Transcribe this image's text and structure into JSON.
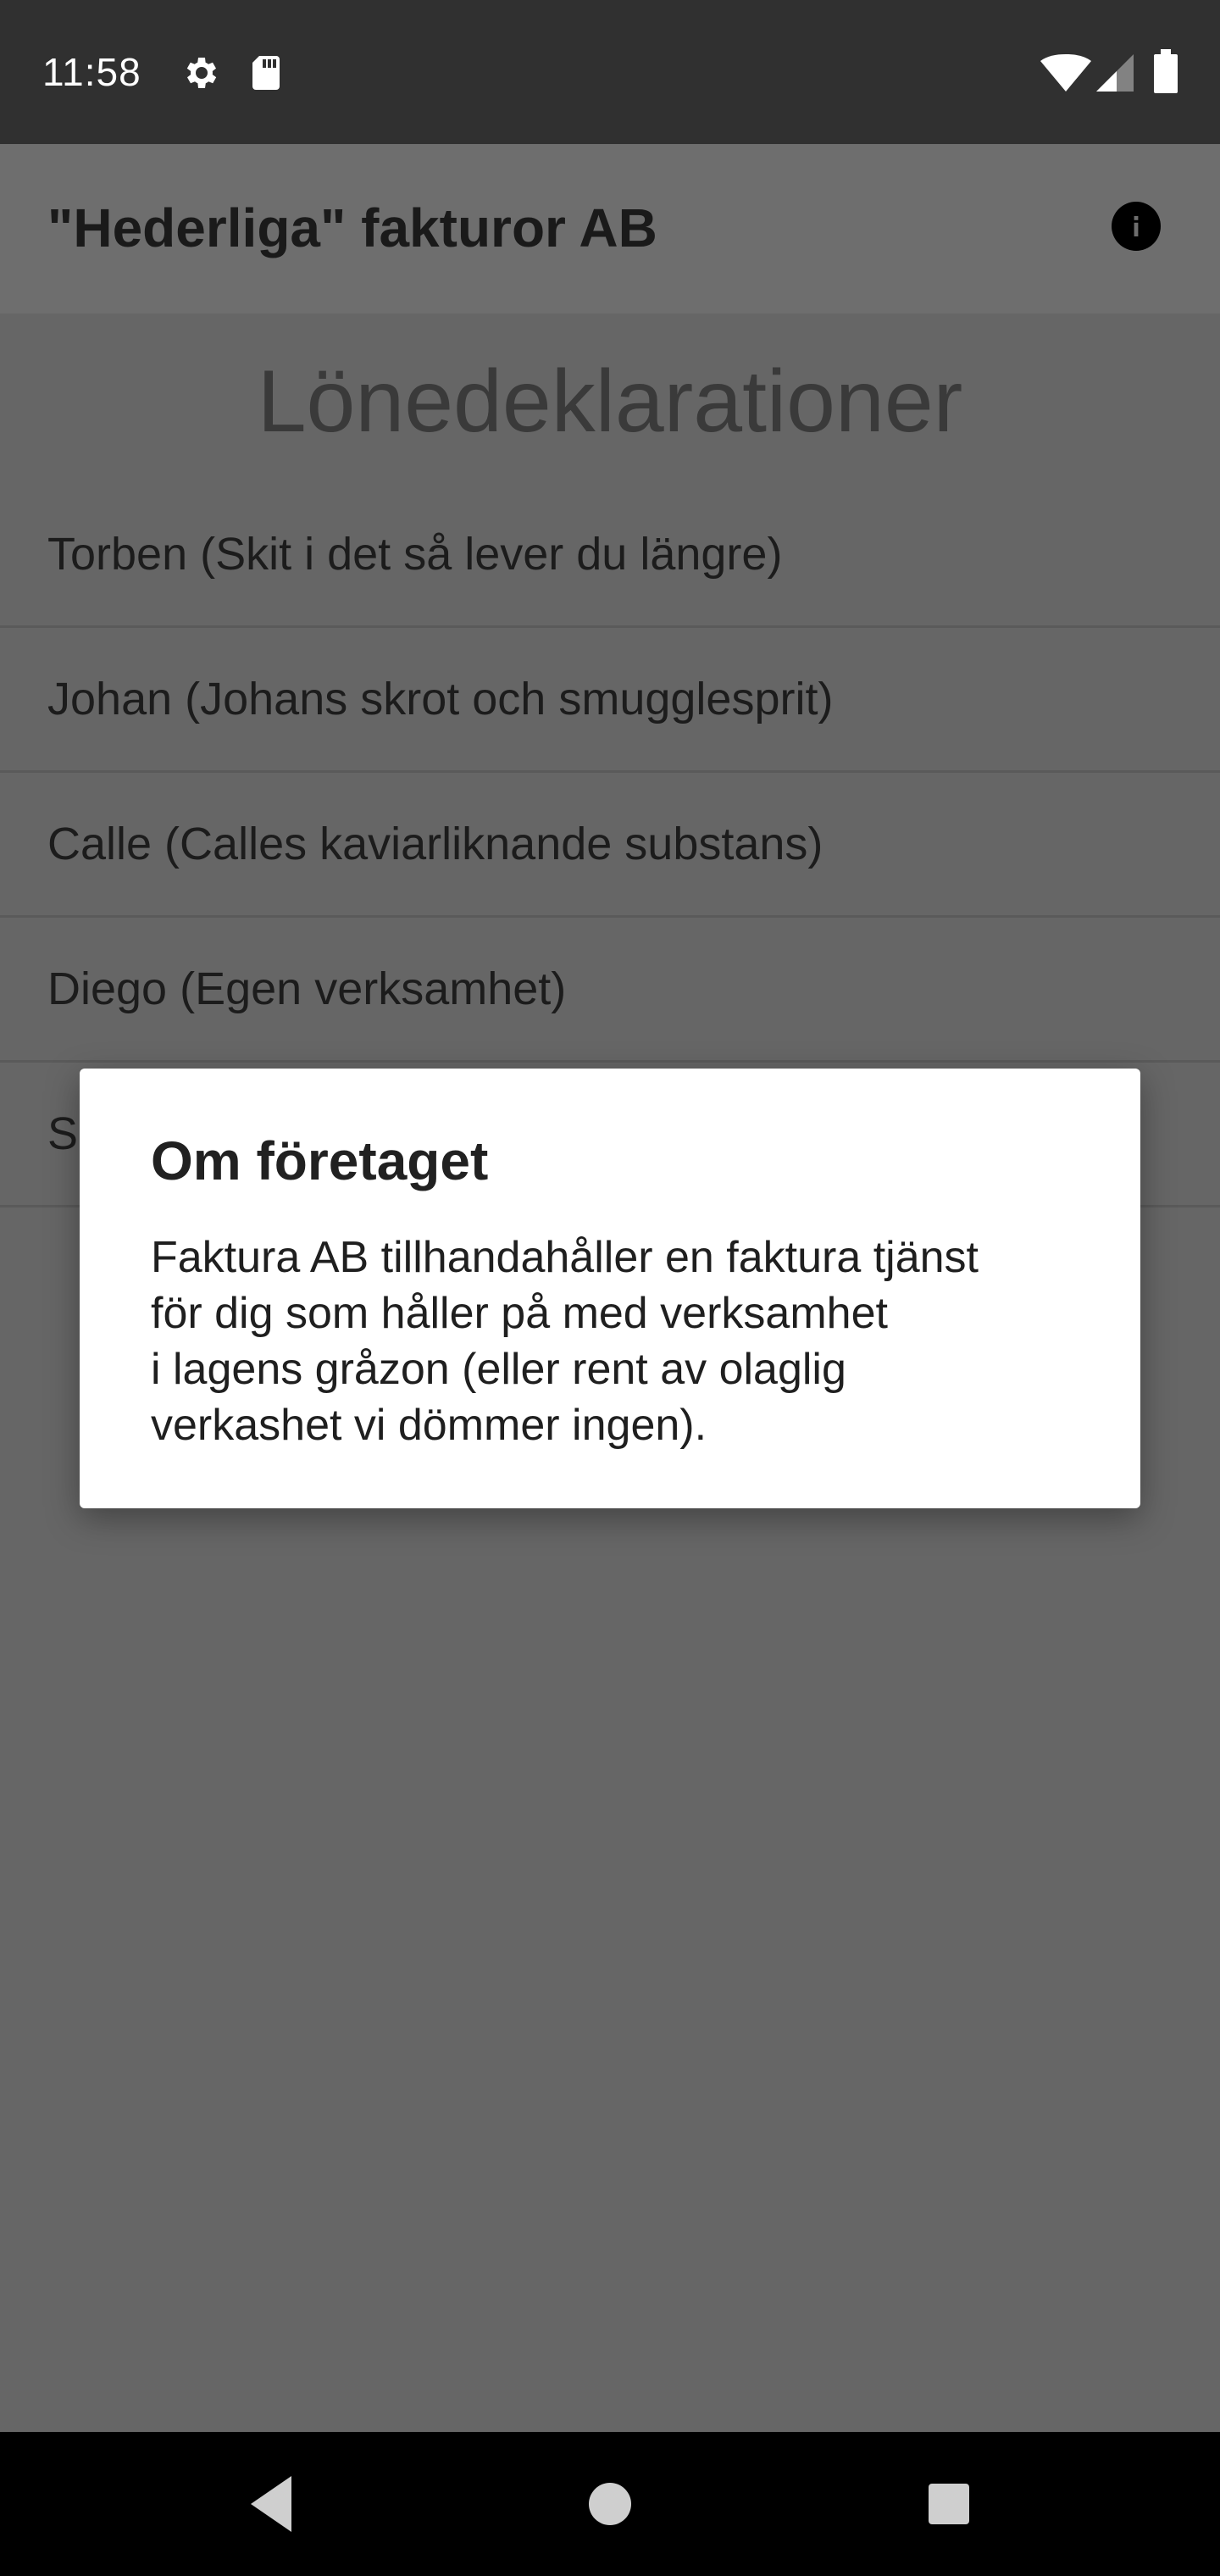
{
  "status_bar": {
    "time": "11:58",
    "icons": [
      "gear-icon",
      "sd-card-icon",
      "wifi-icon",
      "signal-icon",
      "battery-icon"
    ]
  },
  "app_bar": {
    "title": "\"Hederliga\" fakturor AB",
    "info_icon": "info-icon"
  },
  "main": {
    "heading": "Lönedeklarationer",
    "items": [
      {
        "label": "Torben (Skit i det så lever du längre)"
      },
      {
        "label": "Johan (Johans skrot och smugglesprit)"
      },
      {
        "label": "Calle (Calles kaviarliknande substans)"
      },
      {
        "label": "Diego (Egen verksamhet)"
      },
      {
        "label": "S"
      }
    ]
  },
  "dialog": {
    "title": "Om företaget",
    "body": "Faktura AB tillhandahåller en faktura tjänst\nför dig som håller på med verksamhet\ni lagens gråzon (eller rent av olaglig\nverkashet vi dömmer ingen)."
  },
  "nav_bar": {
    "icons": [
      "back-icon",
      "home-icon",
      "recents-icon"
    ]
  },
  "colors": {
    "scrim": "#666666",
    "status_bar": "#303030",
    "dialog_bg": "#ffffff",
    "nav_bar": "#000000"
  }
}
